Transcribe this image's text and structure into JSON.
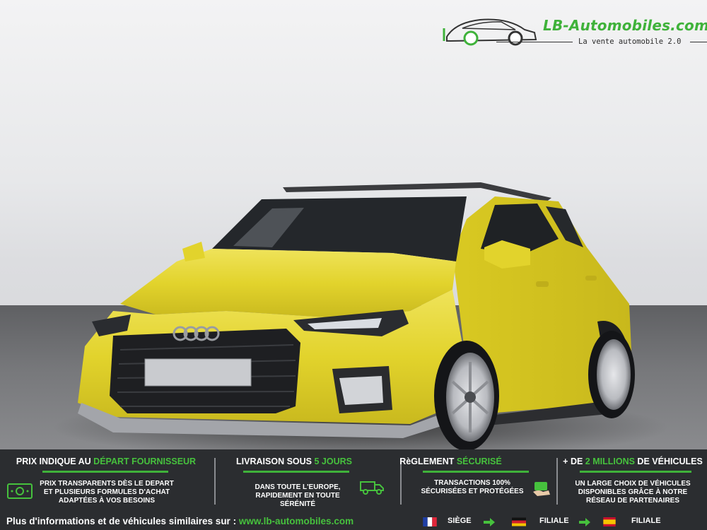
{
  "logo": {
    "title": "LB-Automobiles.com",
    "tagline": "La vente automobile 2.0"
  },
  "banner": {
    "columns": [
      {
        "title_main": "PRIX INDIQUE AU ",
        "title_highlight": "DÉPART FOURNISSEUR",
        "lines": [
          "PRIX TRANSPARENTS DÈS LE DEPART",
          "ET PLUSIEURS FORMULES D'ACHAT",
          "ADAPTÉES À VOS BESOINS"
        ],
        "icon": "money-icon"
      },
      {
        "title_main": "LIVRAISON SOUS ",
        "title_highlight": "5 JOURS",
        "lines": [
          "DANS TOUTE L'EUROPE,",
          "RAPIDEMENT EN TOUTE SÉRÉNITÉ"
        ],
        "icon": "delivery-truck-icon"
      },
      {
        "title_main": "RèGLEMENT ",
        "title_highlight": "SÉCURISÉ",
        "lines": [
          "TRANSACTIONS 100%",
          "SÉCURISÉES ET PROTÉGÉES"
        ],
        "icon": "secure-payment-icon"
      },
      {
        "title_prefix": "+ DE ",
        "title_highlight": "2 MILLIONS",
        "title_main": " DE VÉHICULES",
        "lines": [
          "UN LARGE CHOIX DE VÉHICULES",
          "DISPONIBLES GRÂCE À NOTRE",
          "RÉSEAU DE PARTENAIRES"
        ],
        "icon": ""
      }
    ],
    "footer": {
      "text": "Plus d'informations et de véhicules similaires sur : ",
      "url": "www.lb-automobiles.com",
      "locations": [
        {
          "label": "SIÈGE",
          "flag": "france-flag-icon"
        },
        {
          "label": "FILIALE",
          "flag": "germany-flag-icon"
        },
        {
          "label": "FILIALE",
          "flag": "spain-flag-icon"
        }
      ]
    }
  },
  "colors": {
    "accent_green": "#3fb23a",
    "banner_bg": "#2b2d30",
    "car_body": "#e3d42e"
  }
}
